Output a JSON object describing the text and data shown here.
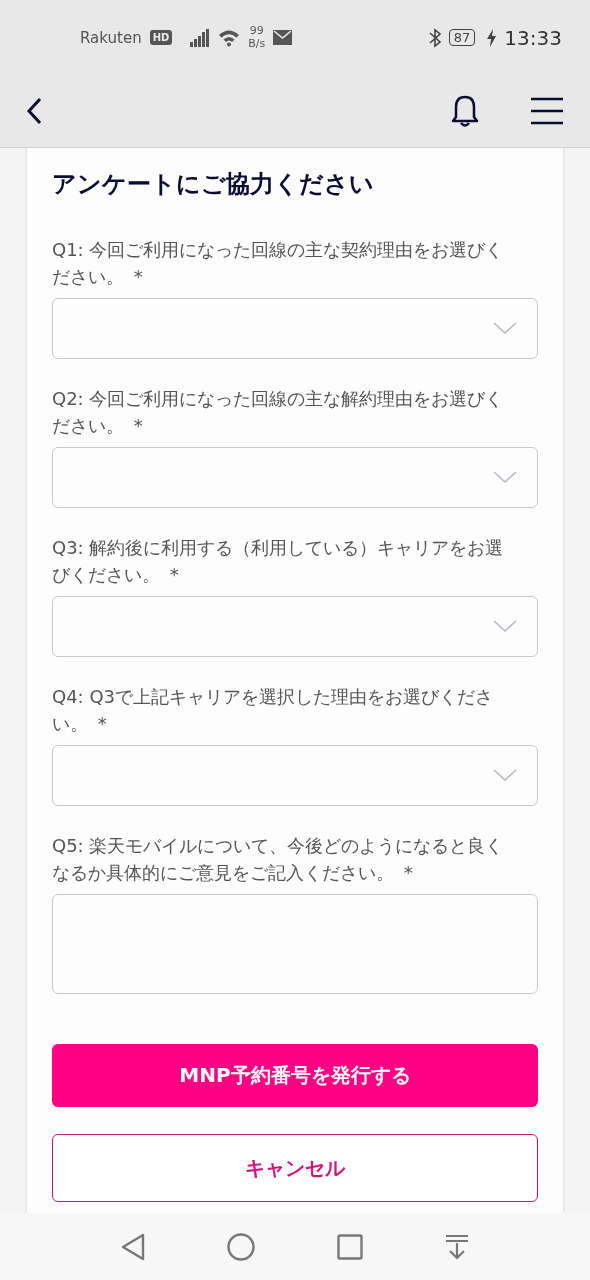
{
  "status_bar": {
    "carrier": "Rakuten",
    "carrier_badge": "HD",
    "net_speed": "99",
    "net_unit": "B/s",
    "battery": "87",
    "time": "13:33"
  },
  "title": "アンケートにご協力ください",
  "questions": [
    {
      "kind": "select",
      "label": "Q1: 今回ご利用になった回線の主な契約理由をお選びください。",
      "required": "*"
    },
    {
      "kind": "select",
      "label": "Q2: 今回ご利用になった回線の主な解約理由をお選びください。",
      "required": "*"
    },
    {
      "kind": "select",
      "label": "Q3: 解約後に利用する（利用している）キャリアをお選びください。",
      "required": "*"
    },
    {
      "kind": "select",
      "label": "Q4: Q3で上記キャリアを選択した理由をお選びください。",
      "required": "*"
    },
    {
      "kind": "text",
      "label": "Q5: 楽天モバイルについて、今後どのようになると良くなるか具体的にご意見をご記入ください。",
      "required": "*"
    }
  ],
  "buttons": [
    {
      "kind": "primary",
      "label": "MNP予約番号を発行する"
    },
    {
      "kind": "secondary",
      "label": "キャンセル"
    }
  ]
}
